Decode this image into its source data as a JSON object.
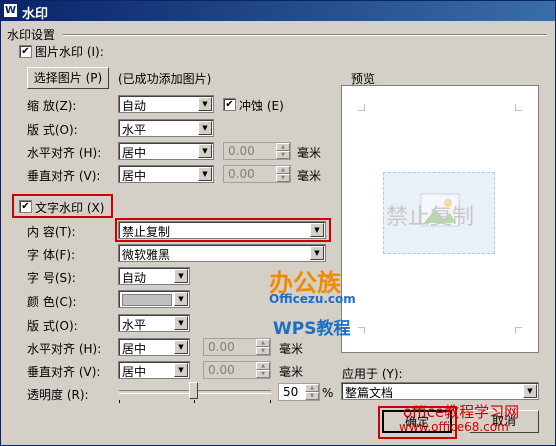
{
  "window": {
    "title": "水印",
    "icon": "wps-w-icon"
  },
  "section_title": "水印设置",
  "picture": {
    "checkbox_label": "图片水印 (I):",
    "checked": true,
    "select_button": "选择图片 (P)",
    "status": "(已成功添加图片)",
    "scale_label": "缩 放(Z):",
    "scale_value": "自动",
    "washout_label": "冲蚀 (E)",
    "washout_checked": true,
    "layout_label": "版 式(O):",
    "layout_value": "水平",
    "halign_label": "水平对齐 (H):",
    "halign_value": "居中",
    "halign_offset": "0.00",
    "valign_label": "垂直对齐 (V):",
    "valign_value": "居中",
    "valign_offset": "0.00",
    "unit": "毫米"
  },
  "text": {
    "checkbox_label": "文字水印 (X)",
    "checked": true,
    "content_label": "内 容(T):",
    "content_value": "禁止复制",
    "font_label": "字 体(F):",
    "font_value": "微软雅黑",
    "size_label": "字 号(S):",
    "size_value": "自动",
    "color_label": "颜 色(C):",
    "layout_label": "版 式(O):",
    "layout_value": "水平",
    "halign_label": "水平对齐 (H):",
    "halign_value": "居中",
    "halign_offset": "0.00",
    "valign_label": "垂直对齐 (V):",
    "valign_value": "居中",
    "valign_offset": "0.00",
    "unit": "毫米",
    "transparency_label": "透明度 (R):",
    "transparency_value": "50",
    "transparency_unit": "%"
  },
  "preview": {
    "label": "预览",
    "watermark_text": "禁止复制"
  },
  "apply_to": {
    "label": "应用于 (Y):",
    "value": "整篇文档"
  },
  "buttons": {
    "ok": "确定",
    "cancel": "取消"
  },
  "overlay": {
    "logo_line1": "办公族",
    "logo_line2": "Officezu.com",
    "wps_line": "WPS教程",
    "site_line1": "office教程学习网",
    "site_line2": "www.office68.com"
  },
  "colors": {
    "title_bar": "#0a246a",
    "highlight_red": "#d00000",
    "watermark_text": "#c8c8c8",
    "logo_orange": "#f08a00",
    "logo_blue": "#1e6fc4"
  }
}
